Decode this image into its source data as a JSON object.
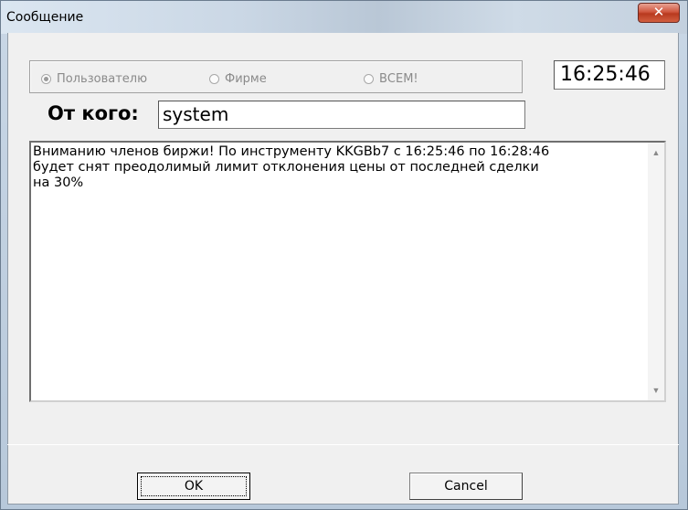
{
  "window": {
    "title": "Сообщение",
    "close_glyph": "✕"
  },
  "recipients": {
    "options": [
      {
        "label": "Пользователю",
        "checked": true
      },
      {
        "label": "Фирме",
        "checked": false
      },
      {
        "label": "ВСЕМ!",
        "checked": false
      }
    ]
  },
  "time": "16:25:46",
  "sender": {
    "label": "От кого:",
    "value": "system"
  },
  "message": {
    "text": "Вниманию членов биржи! По инструменту KKGBb7 с 16:25:46 по 16:28:46\nбудет снят преодолимый лимит отклонения цены от последней сделки\nна 30%",
    "scroll_up_glyph": "▲",
    "scroll_down_glyph": "▼"
  },
  "buttons": {
    "ok": "OK",
    "cancel": "Cancel"
  },
  "colors": {
    "close_button": "#c8472e",
    "disabled_text": "#8a8a8a",
    "panel": "#f0f0f0"
  }
}
